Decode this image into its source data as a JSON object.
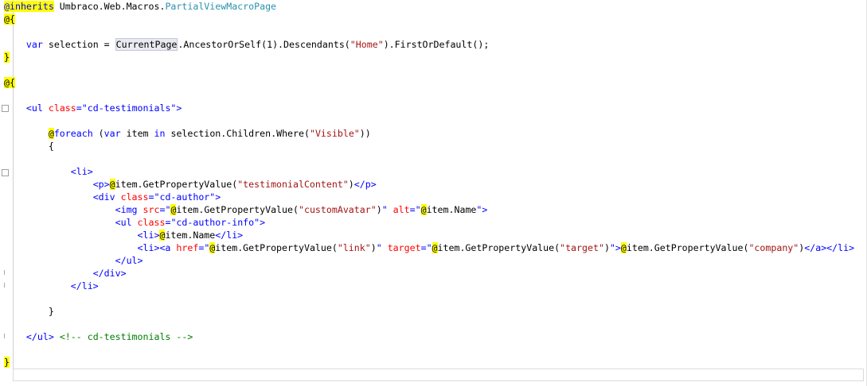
{
  "code": {
    "l1": {
      "inherits": "@inherits",
      "ns": " Umbraco.Web.Macros.",
      "type": "PartialViewMacroPage"
    },
    "l2": {
      "open": "@{"
    },
    "l4": {
      "indent": "    ",
      "var": "var",
      "p1": " selection = ",
      "current": "CurrentPage",
      "p2": ".AncestorOrSelf(1).Descendants(",
      "home": "\"Home\"",
      "p3": ").FirstOrDefault();"
    },
    "l5": {
      "close": "}"
    },
    "l7": {
      "open": "@{"
    },
    "l9": {
      "indent": "    ",
      "tag1": "<ul",
      "sp": " ",
      "attr": "class",
      "eq": "=",
      "val": "\"cd-testimonials\"",
      "tag2": ">"
    },
    "l11": {
      "indent": "        ",
      "at": "@",
      "foreach": "foreach",
      "p1": " (",
      "var": "var",
      "p2": " item ",
      "in": "in",
      "p3": " selection.Children.Where(",
      "vis": "\"Visible\"",
      "p4": "))"
    },
    "l12": {
      "indent": "        ",
      "brace": "{"
    },
    "l14": {
      "indent": "            ",
      "tag": "<li>"
    },
    "l15": {
      "indent": "                ",
      "tag1": "<p>",
      "at": "@",
      "expr": "item.GetPropertyValue(",
      "str": "\"testimonialContent\"",
      "close": ")",
      "tag2": "</p>"
    },
    "l16": {
      "indent": "                ",
      "tag1": "<div",
      "sp": " ",
      "attr": "class",
      "eq": "=",
      "val": "\"cd-author\"",
      "tag2": ">"
    },
    "l17": {
      "indent": "                    ",
      "tag1": "<img",
      "sp": " ",
      "attr1": "src",
      "eq1": "=",
      "q1": "\"",
      "at1": "@",
      "expr1": "item.GetPropertyValue(",
      "str1": "\"customAvatar\"",
      "close1": ")",
      "q2": "\"",
      "sp2": " ",
      "attr2": "alt",
      "eq2": "=",
      "q3": "\"",
      "at2": "@",
      "expr2": "item.Name",
      "q4": "\"",
      "tag2": ">"
    },
    "l18": {
      "indent": "                    ",
      "tag1": "<ul",
      "sp": " ",
      "attr": "class",
      "eq": "=",
      "val": "\"cd-author-info\"",
      "tag2": ">"
    },
    "l19": {
      "indent": "                        ",
      "tag1": "<li>",
      "at": "@",
      "expr": "item.Name",
      "tag2": "</li>"
    },
    "l20": {
      "indent": "                        ",
      "tag1": "<li><a",
      "sp1": " ",
      "attr1": "href",
      "eq1": "=",
      "q1": "\"",
      "at1": "@",
      "expr1": "item.GetPropertyValue(",
      "str1": "\"link\"",
      "close1": ")",
      "q2": "\"",
      "sp2": " ",
      "attr2": "target",
      "eq2": "=",
      "q3": "\"",
      "at2": "@",
      "expr2": "item.GetPropertyValue(",
      "str2": "\"target\"",
      "close2": ")",
      "q4": "\"",
      "gt": ">",
      "at3": "@",
      "expr3": "item.GetPropertyValue(",
      "str3": "\"company\"",
      "close3": ")",
      "tag2": "</a></li>"
    },
    "l21": {
      "indent": "                    ",
      "tag": "</ul>"
    },
    "l22": {
      "indent": "                ",
      "tag": "</div>"
    },
    "l23": {
      "indent": "            ",
      "tag": "</li>"
    },
    "l25": {
      "indent": "        ",
      "brace": "}"
    },
    "l27": {
      "indent": "    ",
      "tag": "</ul>",
      "sp": " ",
      "comment": "<!-- cd-testimonials -->"
    },
    "l29": {
      "close": "}"
    }
  },
  "colors": {
    "keyword": "#0000ff",
    "attribute": "#ff0000",
    "string": "#a31515",
    "type": "#2b91af",
    "comment": "#008000",
    "razor": "#ffff00"
  }
}
